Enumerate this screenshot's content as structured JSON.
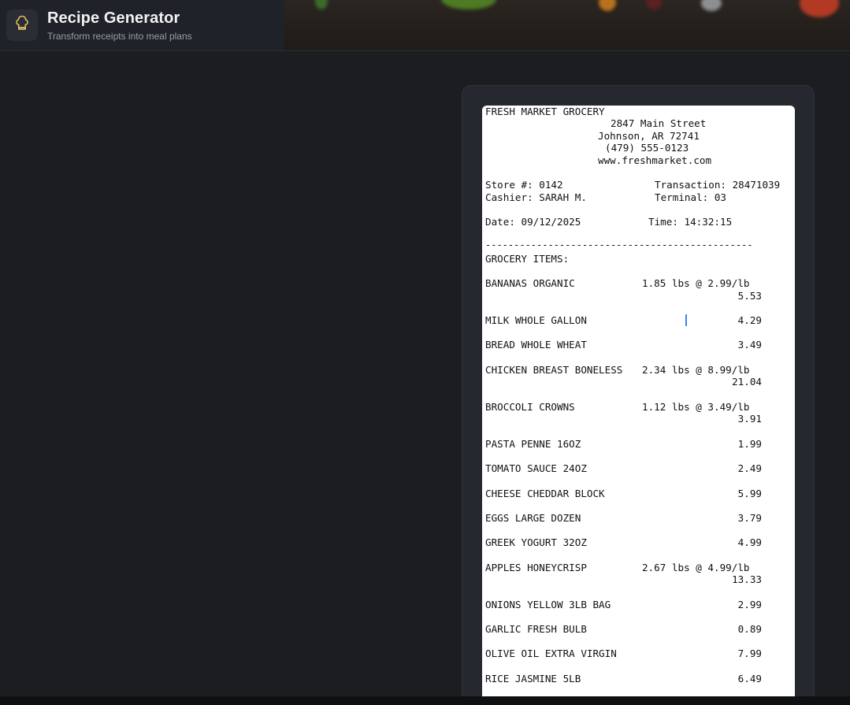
{
  "app": {
    "title": "Recipe Generator",
    "subtitle": "Transform receipts into meal plans",
    "logo_icon": "chef-hat-icon",
    "accent": "#e9c46a"
  },
  "receipt": {
    "store_name": "FRESH MARKET GROCERY",
    "address_line1": "2847 Main Street",
    "address_line2": "Johnson, AR 72741",
    "phone": "(479) 555-0123",
    "website": "www.freshmarket.com",
    "store_number": "Store #: 0142",
    "transaction": "Transaction: 28471039",
    "cashier": "Cashier: SARAH M.",
    "terminal": "Terminal: 03",
    "date": "Date: 09/12/2025",
    "time": "Time: 14:32:15",
    "divider": "-----------------------------------------------",
    "section_title": "GROCERY ITEMS:",
    "items": [
      {
        "name": "BANANAS ORGANIC",
        "qty": "1.85 lbs @ 2.99/lb",
        "price": "5.53"
      },
      {
        "name": "MILK WHOLE GALLON",
        "qty": "",
        "price": "4.29"
      },
      {
        "name": "BREAD WHOLE WHEAT",
        "qty": "",
        "price": "3.49"
      },
      {
        "name": "CHICKEN BREAST BONELESS",
        "qty": "2.34 lbs @ 8.99/lb",
        "price": "21.04"
      },
      {
        "name": "BROCCOLI CROWNS",
        "qty": "1.12 lbs @ 3.49/lb",
        "price": "3.91"
      },
      {
        "name": "PASTA PENNE 16OZ",
        "qty": "",
        "price": "1.99"
      },
      {
        "name": "TOMATO SAUCE 24OZ",
        "qty": "",
        "price": "2.49"
      },
      {
        "name": "CHEESE CHEDDAR BLOCK",
        "qty": "",
        "price": "5.99"
      },
      {
        "name": "EGGS LARGE DOZEN",
        "qty": "",
        "price": "3.79"
      },
      {
        "name": "GREEK YOGURT 32OZ",
        "qty": "",
        "price": "4.99"
      },
      {
        "name": "APPLES HONEYCRISP",
        "qty": "2.67 lbs @ 4.99/lb",
        "price": "13.33"
      },
      {
        "name": "ONIONS YELLOW 3LB BAG",
        "qty": "",
        "price": "2.99"
      },
      {
        "name": "GARLIC FRESH BULB",
        "qty": "",
        "price": "0.89"
      },
      {
        "name": "OLIVE OIL EXTRA VIRGIN",
        "qty": "",
        "price": "7.99"
      },
      {
        "name": "RICE JASMINE 5LB",
        "qty": "",
        "price": "6.49"
      }
    ]
  }
}
